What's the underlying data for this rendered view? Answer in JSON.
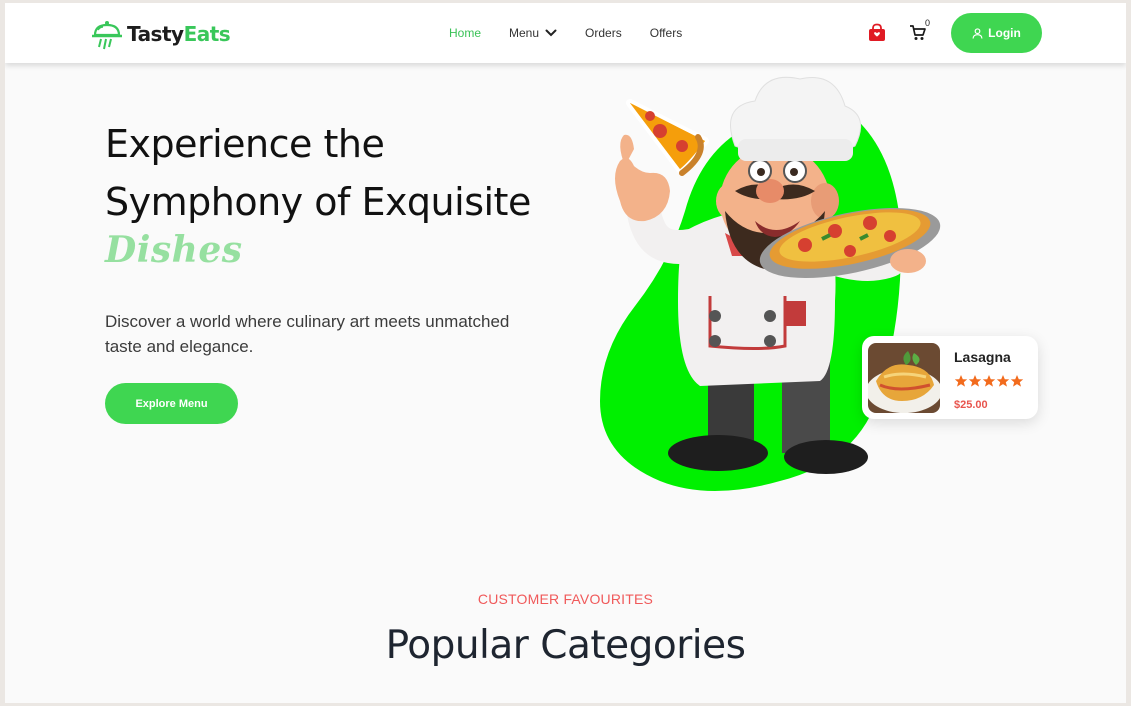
{
  "brand": {
    "name_part1": "Tasty",
    "name_part2": "Eats",
    "primary_color": "#3fd651",
    "accent_text_color": "#96e0a0",
    "label_color": "#f0595a"
  },
  "nav": {
    "links": [
      {
        "label": "Home",
        "active": true
      },
      {
        "label": "Menu",
        "active": false,
        "has_dropdown": true
      },
      {
        "label": "Orders",
        "active": false
      },
      {
        "label": "Offers",
        "active": false
      }
    ],
    "cart_count": "0",
    "login_label": "Login",
    "icons": [
      "shopping-bag-icon",
      "cart-icon",
      "user-icon",
      "chevron-down-icon"
    ]
  },
  "hero": {
    "title_line1": "Experience the",
    "title_line2": "Symphony of Exquisite",
    "title_accent": "Dishes",
    "description": "Discover a world where culinary art meets unmatched taste and elegance.",
    "cta_label": "Explore Menu"
  },
  "featured_card": {
    "name": "Lasagna",
    "rating": 5,
    "price": "$25.00"
  },
  "section": {
    "label": "CUSTOMER FAVOURITES",
    "title": "Popular Categories"
  }
}
